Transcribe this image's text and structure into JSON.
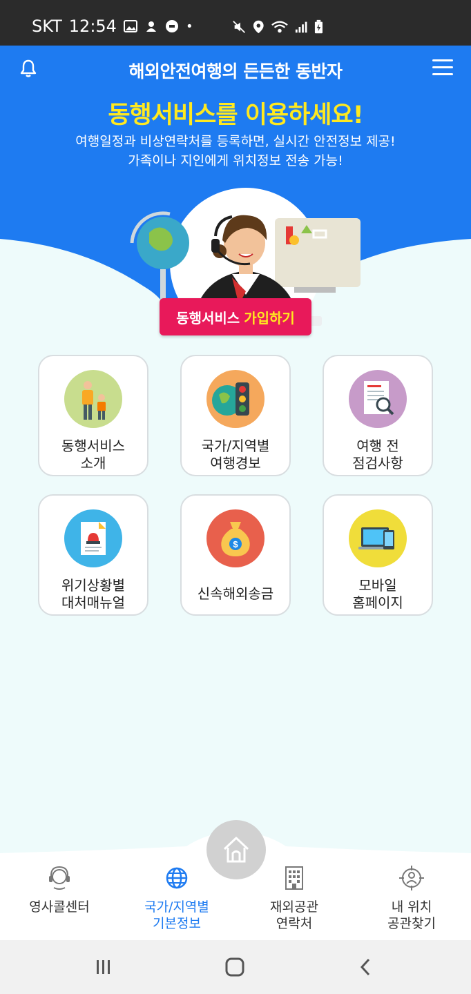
{
  "status_bar": {
    "carrier": "SKT",
    "time": "12:54",
    "dot": "•"
  },
  "header": {
    "title": "해외안전여행의 든든한 동반자",
    "headline": "동행서비스를 이용하세요!",
    "subtitle_line1": "여행일정과 비상연락처를 등록하면, 실시간 안전정보 제공!",
    "subtitle_line2": "가족이나 지인에게 위치정보 전송 가능!"
  },
  "join_button": {
    "label_part1": "동행서비스",
    "label_part2": "가입하기"
  },
  "menu_cards": [
    {
      "line1": "동행서비스",
      "line2": "소개",
      "icon": "family-icon",
      "color": "#c8dd8e"
    },
    {
      "line1": "국가/지역별",
      "line2": "여행경보",
      "icon": "traffic-light-icon",
      "color": "#f5a85c"
    },
    {
      "line1": "여행 전",
      "line2": "점검사항",
      "icon": "checklist-icon",
      "color": "#c79bc9"
    },
    {
      "line1": "위기상황별",
      "line2": "대처매뉴얼",
      "icon": "manual-icon",
      "color": "#3fb4e8"
    },
    {
      "line1": "신속해외송금",
      "line2": "",
      "icon": "money-bag-icon",
      "color": "#e8604c"
    },
    {
      "line1": "모바일",
      "line2": "홈페이지",
      "icon": "devices-icon",
      "color": "#f0dd3a"
    }
  ],
  "bottom_nav": [
    {
      "line1": "영사콜센터",
      "line2": "",
      "icon": "headset-icon"
    },
    {
      "line1": "국가/지역별",
      "line2": "기본정보",
      "icon": "globe-icon"
    },
    {
      "line1": "재외공관",
      "line2": "연락처",
      "icon": "building-icon"
    },
    {
      "line1": "내 위치",
      "line2": "공관찾기",
      "icon": "location-target-icon"
    }
  ],
  "colors": {
    "brand_blue": "#1e7bf1",
    "accent_yellow": "#ffe91f",
    "join_pink": "#e8195a",
    "background": "#eefbfb"
  }
}
